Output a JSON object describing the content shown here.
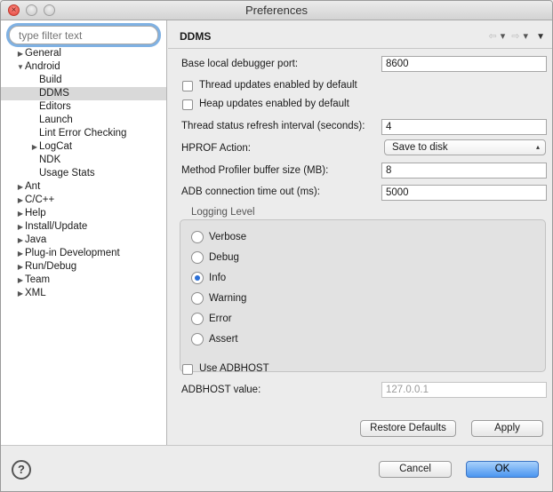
{
  "window": {
    "title": "Preferences"
  },
  "filter": {
    "placeholder": "type filter text"
  },
  "tree": [
    {
      "label": "General",
      "level": 0,
      "arrow": "right"
    },
    {
      "label": "Android",
      "level": 0,
      "arrow": "down"
    },
    {
      "label": "Build",
      "level": 1,
      "arrow": ""
    },
    {
      "label": "DDMS",
      "level": 1,
      "arrow": "",
      "selected": true
    },
    {
      "label": "Editors",
      "level": 1,
      "arrow": ""
    },
    {
      "label": "Launch",
      "level": 1,
      "arrow": ""
    },
    {
      "label": "Lint Error Checking",
      "level": 1,
      "arrow": ""
    },
    {
      "label": "LogCat",
      "level": 1,
      "arrow": "right"
    },
    {
      "label": "NDK",
      "level": 1,
      "arrow": ""
    },
    {
      "label": "Usage Stats",
      "level": 1,
      "arrow": ""
    },
    {
      "label": "Ant",
      "level": 0,
      "arrow": "right"
    },
    {
      "label": "C/C++",
      "level": 0,
      "arrow": "right"
    },
    {
      "label": "Help",
      "level": 0,
      "arrow": "right"
    },
    {
      "label": "Install/Update",
      "level": 0,
      "arrow": "right"
    },
    {
      "label": "Java",
      "level": 0,
      "arrow": "right"
    },
    {
      "label": "Plug-in Development",
      "level": 0,
      "arrow": "right"
    },
    {
      "label": "Run/Debug",
      "level": 0,
      "arrow": "right"
    },
    {
      "label": "Team",
      "level": 0,
      "arrow": "right"
    },
    {
      "label": "XML",
      "level": 0,
      "arrow": "right"
    }
  ],
  "page": {
    "title": "DDMS",
    "base_port_label": "Base local debugger port:",
    "base_port_value": "8600",
    "thread_updates_label": "Thread updates enabled by default",
    "heap_updates_label": "Heap updates enabled by default",
    "thread_interval_label": "Thread status refresh interval (seconds):",
    "thread_interval_value": "4",
    "hprof_label": "HPROF Action:",
    "hprof_value": "Save to disk",
    "profiler_label": "Method Profiler buffer size (MB):",
    "profiler_value": "8",
    "adb_timeout_label": "ADB connection time out (ms):",
    "adb_timeout_value": "5000",
    "logging_title": "Logging Level",
    "logging_levels": [
      "Verbose",
      "Debug",
      "Info",
      "Warning",
      "Error",
      "Assert"
    ],
    "logging_selected": "Info",
    "use_adbhost_label": "Use ADBHOST",
    "adbhost_value_label": "ADBHOST value:",
    "adbhost_value": "127.0.0.1",
    "restore_defaults": "Restore Defaults",
    "apply": "Apply"
  },
  "footer": {
    "help": "?",
    "cancel": "Cancel",
    "ok": "OK"
  }
}
